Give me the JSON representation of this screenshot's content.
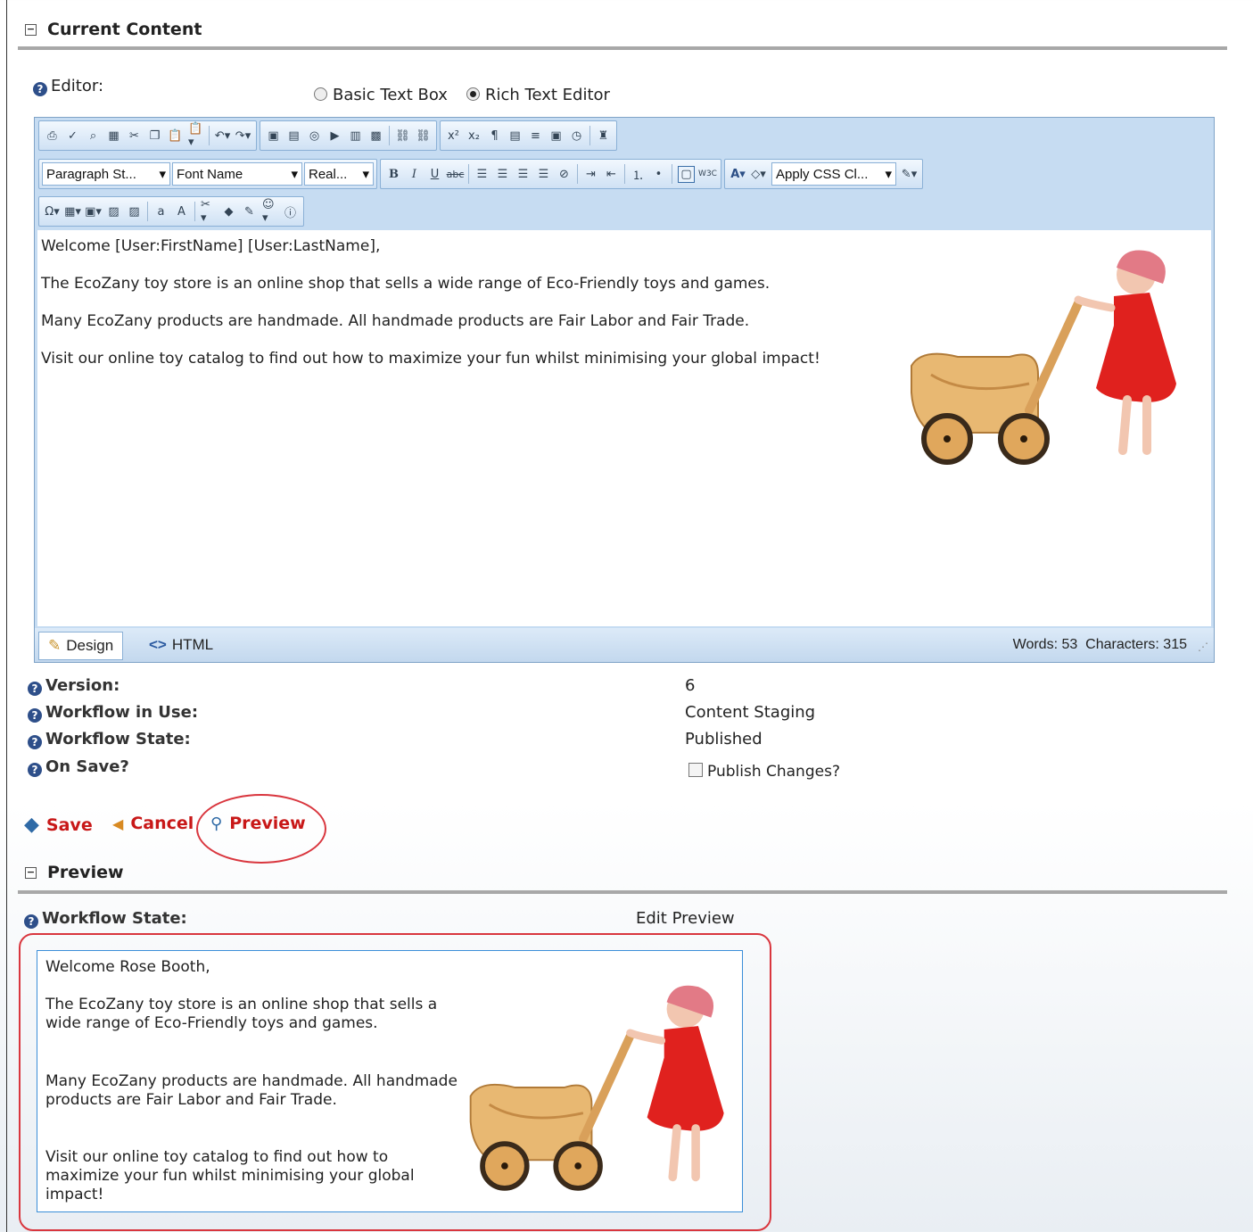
{
  "current_section": {
    "title": "Current Content",
    "toggle": "⊟"
  },
  "editor_field": {
    "label": "Editor:",
    "options": [
      "Basic Text Box",
      "Rich Text Editor"
    ],
    "selected": "Rich Text Editor"
  },
  "toolbar": {
    "paragraph_style": "Paragraph St...",
    "font_name": "Font Name",
    "font_size": "Real...",
    "css_class": "Apply CSS Cl..."
  },
  "editor_content": {
    "line1": "Welcome [User:FirstName] [User:LastName],",
    "line2": "The EcoZany toy store is an online shop that sells a wide range of Eco-Friendly toys and games.",
    "line3": "Many EcoZany products are handmade. All handmade products are Fair Labor and Fair Trade.",
    "line4": "Visit our online toy catalog to find out how to maximize your fun whilst minimising your global impact!"
  },
  "editor_footer": {
    "design_tab": "Design",
    "html_tab": "HTML",
    "words": "Words: 53",
    "characters": "Characters: 315"
  },
  "info": {
    "version_label": "Version:",
    "version_value": "6",
    "workflow_label": "Workflow in Use:",
    "workflow_value": "Content Staging",
    "state_label": "Workflow State:",
    "state_value": "Published",
    "onsave_label": "On Save?",
    "onsave_option": "Publish Changes?"
  },
  "actions": {
    "save": "Save",
    "cancel": "Cancel",
    "preview": "Preview"
  },
  "preview_section": {
    "title": "Preview",
    "toggle": "⊟",
    "state_label": "Workflow State:",
    "state_value": "Edit Preview",
    "p1": "Welcome Rose Booth,",
    "p2": "The EcoZany toy store is an online shop that sells a wide range of Eco-Friendly toys and games.",
    "p3": "Many EcoZany products are handmade. All handmade products are Fair Labor and Fair Trade.",
    "p4": "Visit our online toy catalog to find out how to maximize your fun whilst minimising your global impact!"
  },
  "colors": {
    "action_red": "#c81818",
    "ring_red": "#d9363e",
    "toolbar_blue": "#c6dcf2",
    "preview_border": "#3b8ed8"
  }
}
